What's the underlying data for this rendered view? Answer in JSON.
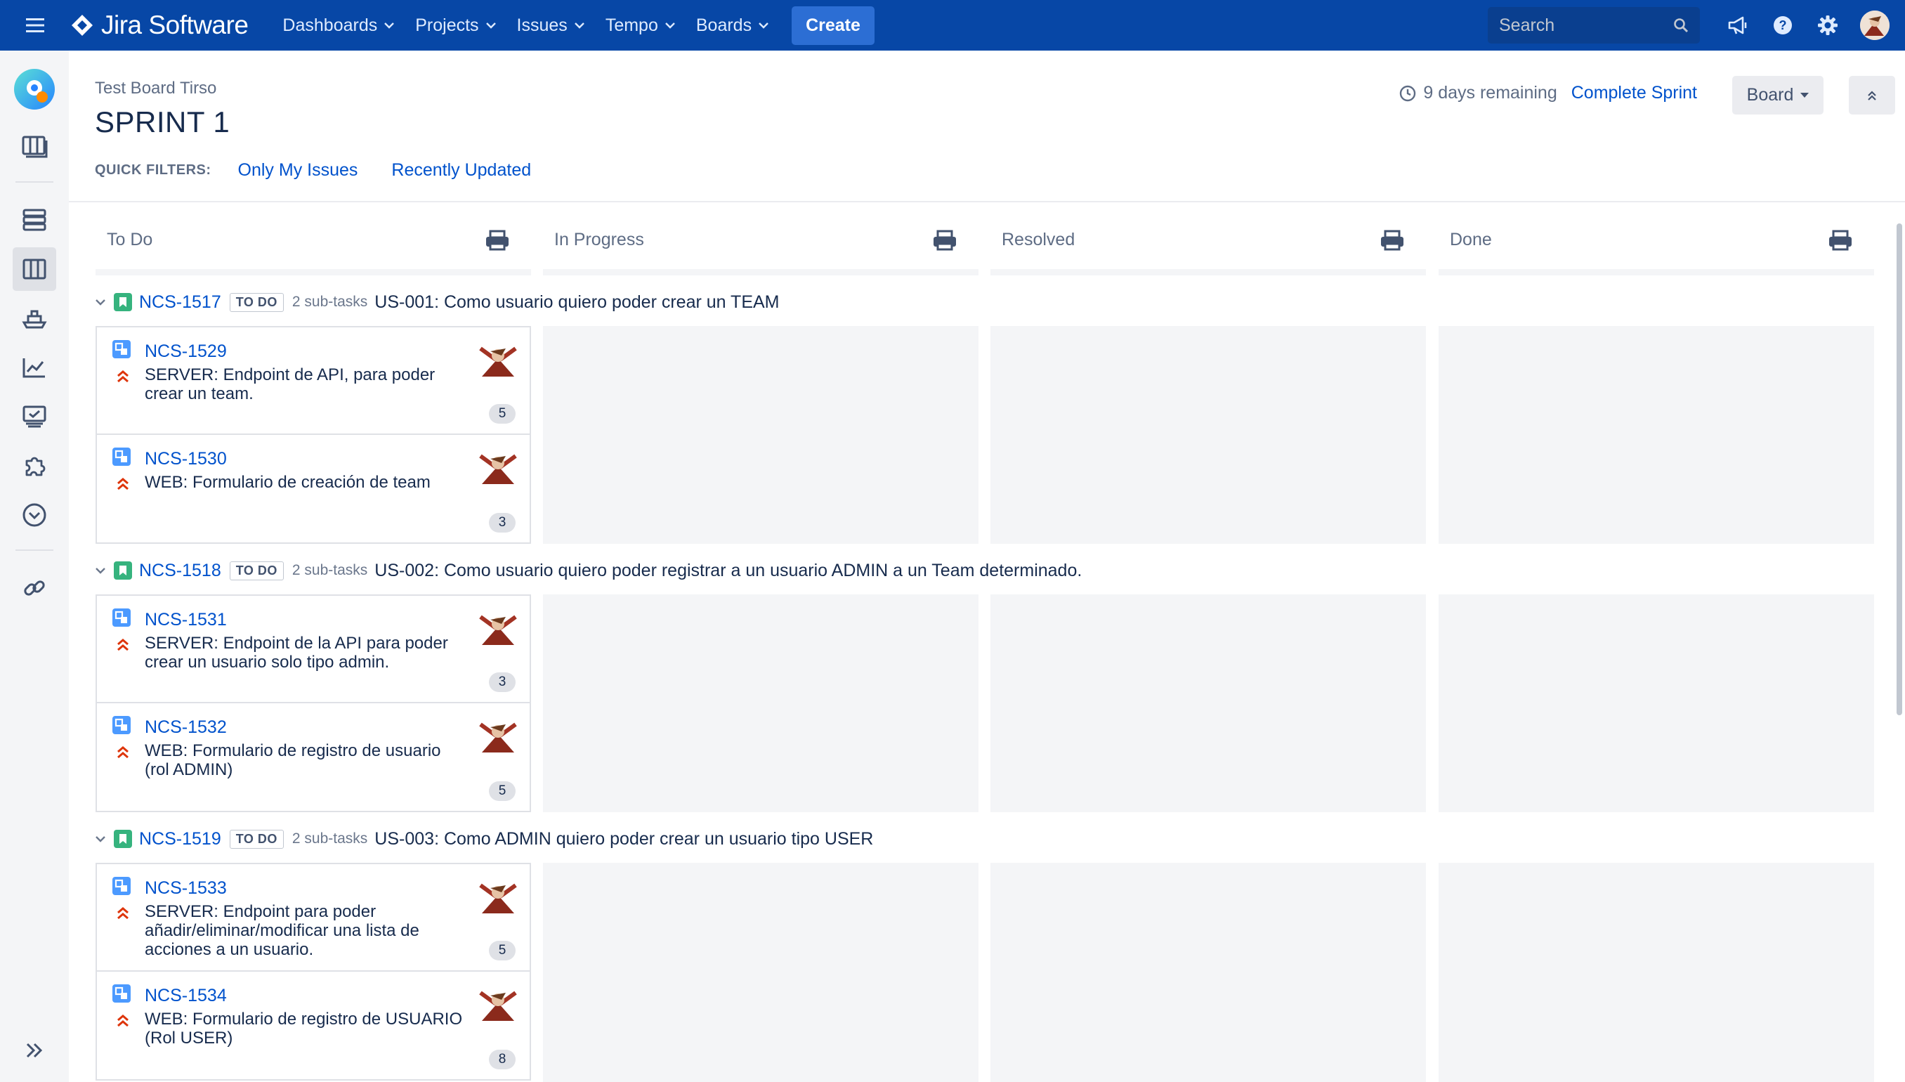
{
  "topnav": {
    "app_name": "Jira Software",
    "items": [
      {
        "label": "Dashboards"
      },
      {
        "label": "Projects"
      },
      {
        "label": "Issues"
      },
      {
        "label": "Tempo"
      },
      {
        "label": "Boards"
      }
    ],
    "create_label": "Create",
    "search_placeholder": "Search"
  },
  "header": {
    "breadcrumb": "Test Board Tirso",
    "title": "SPRINT 1",
    "remaining": "9 days remaining",
    "complete_label": "Complete Sprint",
    "board_label": "Board"
  },
  "quick_filters": {
    "label": "QUICK FILTERS:",
    "items": [
      "Only My Issues",
      "Recently Updated"
    ]
  },
  "columns": [
    "To Do",
    "In Progress",
    "Resolved",
    "Done"
  ],
  "swimlanes": [
    {
      "key": "NCS-1517",
      "status": "TO DO",
      "subtasks": "2 sub-tasks",
      "summary": "US-001: Como usuario quiero poder crear un TEAM",
      "cards": [
        {
          "key": "NCS-1529",
          "summary": "SERVER: Endpoint de API, para poder crear un team.",
          "points": "5"
        },
        {
          "key": "NCS-1530",
          "summary": "WEB: Formulario de creación de team",
          "points": "3"
        }
      ]
    },
    {
      "key": "NCS-1518",
      "status": "TO DO",
      "subtasks": "2 sub-tasks",
      "summary": "US-002: Como usuario quiero poder registrar a un usuario ADMIN a un Team determinado.",
      "cards": [
        {
          "key": "NCS-1531",
          "summary": "SERVER: Endpoint de la API para poder crear un usuario solo tipo admin.",
          "points": "3"
        },
        {
          "key": "NCS-1532",
          "summary": "WEB: Formulario de registro de usuario (rol ADMIN)",
          "points": "5"
        }
      ]
    },
    {
      "key": "NCS-1519",
      "status": "TO DO",
      "subtasks": "2 sub-tasks",
      "summary": "US-003: Como ADMIN quiero poder crear un usuario tipo USER",
      "cards": [
        {
          "key": "NCS-1533",
          "summary": "SERVER: Endpoint para poder añadir/eliminar/modificar una lista de acciones a un usuario.",
          "points": "5"
        },
        {
          "key": "NCS-1534",
          "summary": "WEB: Formulario de registro de USUARIO (Rol USER)",
          "points": "8"
        }
      ]
    }
  ],
  "colors": {
    "nav_bg": "#0747a6",
    "link": "#0052cc",
    "story": "#36b37e",
    "subtask": "#4c9aff",
    "priority_high": "#de350b"
  }
}
